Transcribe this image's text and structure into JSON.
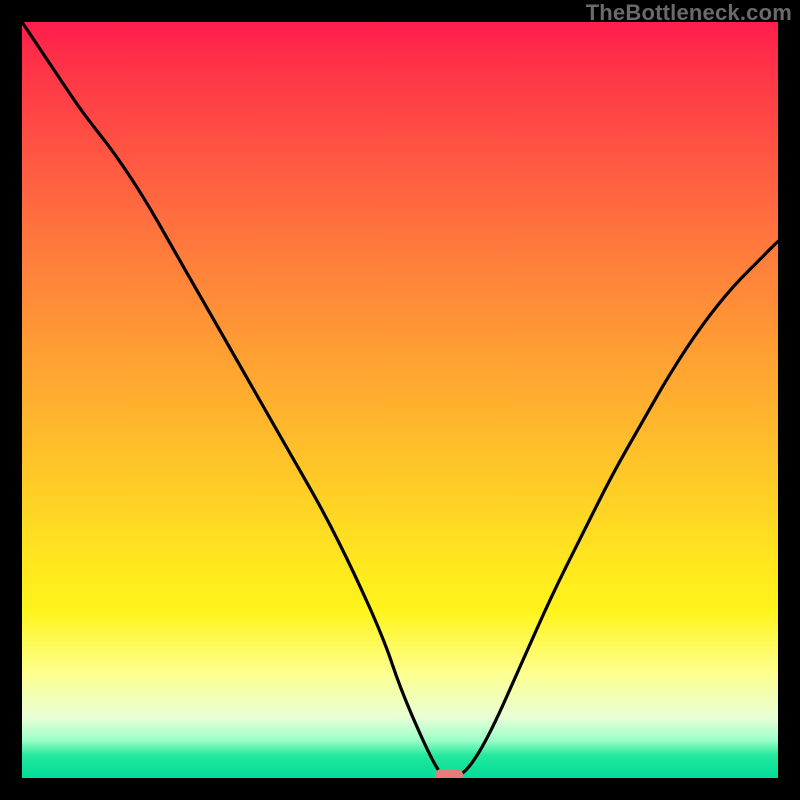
{
  "watermark": "TheBottleneck.com",
  "colors": {
    "curve_stroke": "#000000",
    "marker_fill": "#e77a7a",
    "background_frame": "#000000"
  },
  "chart_data": {
    "type": "line",
    "title": "",
    "xlabel": "",
    "ylabel": "",
    "xlim": [
      0,
      100
    ],
    "ylim": [
      0,
      100
    ],
    "grid": false,
    "legend": null,
    "series": [
      {
        "name": "bottleneck-curve",
        "x": [
          0,
          4,
          8,
          12,
          16,
          20,
          24,
          28,
          32,
          36,
          40,
          44,
          48,
          50,
          53,
          55,
          56,
          57,
          59,
          62,
          66,
          70,
          74,
          78,
          82,
          86,
          90,
          94,
          98,
          100
        ],
        "y": [
          100,
          94,
          88,
          83,
          77,
          70,
          63,
          56,
          49,
          42,
          35,
          27,
          18,
          12,
          5,
          1,
          0,
          0,
          1,
          6,
          15,
          24,
          32,
          40,
          47,
          54,
          60,
          65,
          69,
          71
        ]
      }
    ],
    "marker": {
      "x": 56.5,
      "y": 0
    },
    "background_gradient": {
      "stops": [
        {
          "pos": 0.0,
          "color": "#ff1d4c"
        },
        {
          "pos": 0.3,
          "color": "#ff7a3c"
        },
        {
          "pos": 0.64,
          "color": "#ffd324"
        },
        {
          "pos": 0.86,
          "color": "#fdff8d"
        },
        {
          "pos": 1.0,
          "color": "#00dd99"
        }
      ]
    }
  }
}
